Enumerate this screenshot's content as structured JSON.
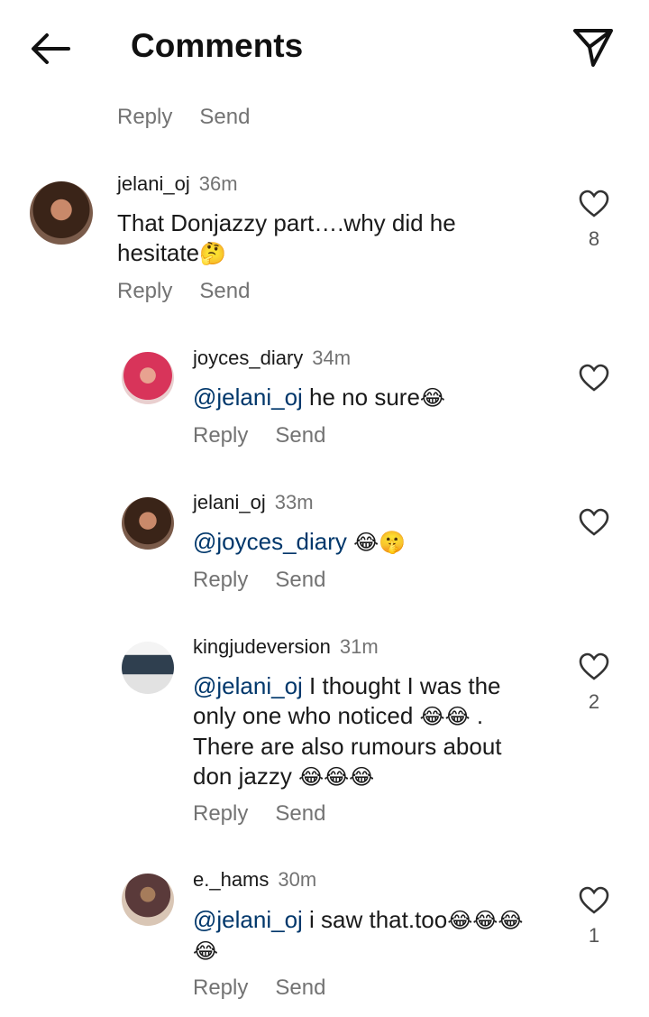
{
  "header": {
    "title": "Comments"
  },
  "actions": {
    "reply": "Reply",
    "send": "Send"
  },
  "comments": [
    {
      "username": "jelani_oj",
      "time": "36m",
      "text": "That Donjazzy part….why did he hesitate",
      "emoji": "🤔",
      "likes": "8"
    },
    {
      "username": "joyces_diary",
      "time": "34m",
      "mention": "@jelani_oj",
      "text": " he no sure",
      "emoji": "😂",
      "likes": ""
    },
    {
      "username": "jelani_oj",
      "time": "33m",
      "mention": "@joyces_diary",
      "text": " ",
      "emoji": "😂🤫",
      "likes": ""
    },
    {
      "username": "kingjudeversion",
      "time": "31m",
      "mention": "@jelani_oj",
      "text": " I thought I was the only one who noticed ",
      "emoji": "😂😂",
      "text2": " . There are also rumours about don jazzy ",
      "emoji2": "😂😂😂",
      "likes": "2"
    },
    {
      "username": "e._hams",
      "time": "30m",
      "mention": "@jelani_oj",
      "text": " i saw that.too",
      "emoji": "😂😂😂😂",
      "likes": "1"
    }
  ]
}
